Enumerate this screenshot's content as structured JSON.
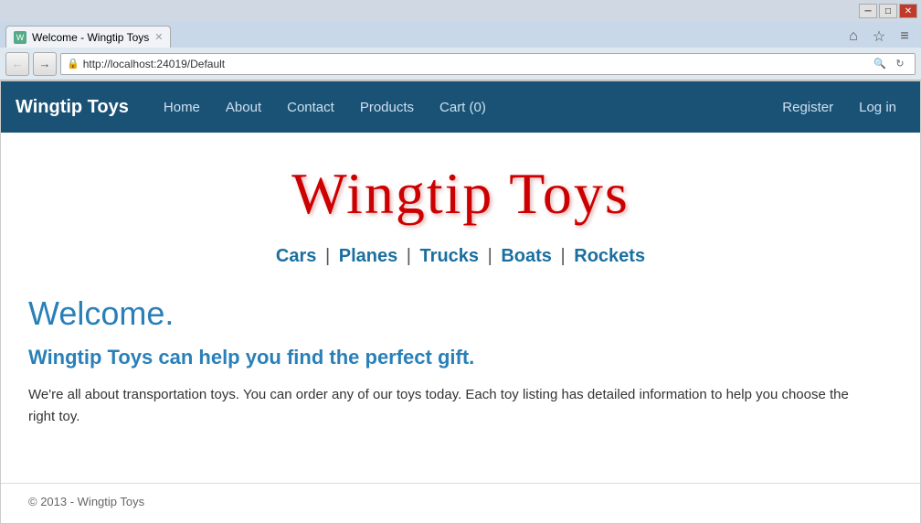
{
  "browser": {
    "title_bar": {
      "minimize": "─",
      "maximize": "□",
      "close": "✕"
    },
    "address": "http://localhost:24019/Default",
    "tab_label": "Welcome - Wingtip Toys",
    "actions": {
      "home": "⌂",
      "star": "☆",
      "settings": "≡"
    }
  },
  "navbar": {
    "brand": "Wingtip Toys",
    "links": [
      {
        "label": "Home"
      },
      {
        "label": "About"
      },
      {
        "label": "Contact"
      },
      {
        "label": "Products"
      },
      {
        "label": "Cart (0)"
      }
    ],
    "right_links": [
      {
        "label": "Register"
      },
      {
        "label": "Log in"
      }
    ]
  },
  "content": {
    "site_title": "Wingtip Toys",
    "categories": [
      {
        "label": "Cars"
      },
      {
        "label": "Planes"
      },
      {
        "label": "Trucks"
      },
      {
        "label": "Boats"
      },
      {
        "label": "Rockets"
      }
    ],
    "welcome_heading": "Welcome.",
    "tagline": "Wingtip Toys can help you find the perfect gift.",
    "description": "We're all about transportation toys. You can order any of our toys today. Each toy listing has detailed information to help you choose the right toy."
  },
  "footer": {
    "copyright": "© 2013 - Wingtip Toys"
  }
}
